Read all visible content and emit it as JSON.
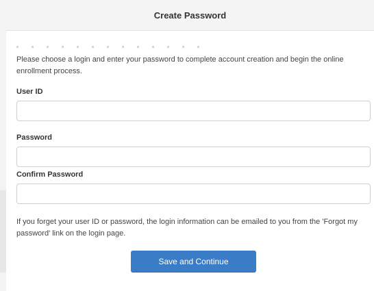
{
  "header": {
    "title": "Create Password"
  },
  "intro": {
    "text": "Please choose a login and enter your password to complete account creation and begin the online enrollment process."
  },
  "form": {
    "user_id": {
      "label": "User ID",
      "value": ""
    },
    "password": {
      "label": "Password",
      "value": ""
    },
    "confirm_password": {
      "label": "Confirm Password",
      "value": ""
    }
  },
  "help": {
    "text": "If you forget your user ID or password, the login information can be emailed to you from the 'Forgot my password' link on the login page."
  },
  "actions": {
    "submit_label": "Save and Continue"
  },
  "colors": {
    "primary_button": "#3b7cc6",
    "header_background": "#f4f4f4"
  }
}
